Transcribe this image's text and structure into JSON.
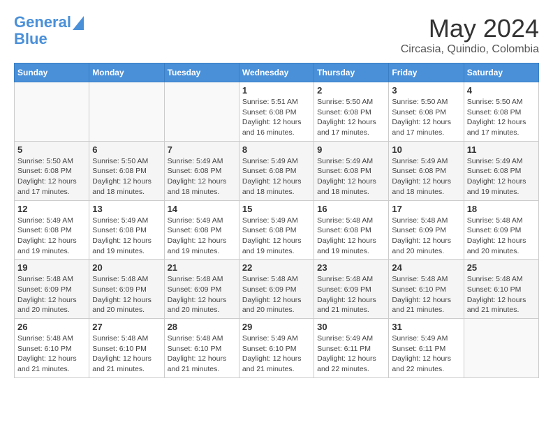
{
  "header": {
    "logo_line1": "General",
    "logo_line2": "Blue",
    "month": "May 2024",
    "location": "Circasia, Quindio, Colombia"
  },
  "days_of_week": [
    "Sunday",
    "Monday",
    "Tuesday",
    "Wednesday",
    "Thursday",
    "Friday",
    "Saturday"
  ],
  "weeks": [
    [
      {
        "day": "",
        "info": ""
      },
      {
        "day": "",
        "info": ""
      },
      {
        "day": "",
        "info": ""
      },
      {
        "day": "1",
        "info": "Sunrise: 5:51 AM\nSunset: 6:08 PM\nDaylight: 12 hours\nand 16 minutes."
      },
      {
        "day": "2",
        "info": "Sunrise: 5:50 AM\nSunset: 6:08 PM\nDaylight: 12 hours\nand 17 minutes."
      },
      {
        "day": "3",
        "info": "Sunrise: 5:50 AM\nSunset: 6:08 PM\nDaylight: 12 hours\nand 17 minutes."
      },
      {
        "day": "4",
        "info": "Sunrise: 5:50 AM\nSunset: 6:08 PM\nDaylight: 12 hours\nand 17 minutes."
      }
    ],
    [
      {
        "day": "5",
        "info": "Sunrise: 5:50 AM\nSunset: 6:08 PM\nDaylight: 12 hours\nand 17 minutes."
      },
      {
        "day": "6",
        "info": "Sunrise: 5:50 AM\nSunset: 6:08 PM\nDaylight: 12 hours\nand 18 minutes."
      },
      {
        "day": "7",
        "info": "Sunrise: 5:49 AM\nSunset: 6:08 PM\nDaylight: 12 hours\nand 18 minutes."
      },
      {
        "day": "8",
        "info": "Sunrise: 5:49 AM\nSunset: 6:08 PM\nDaylight: 12 hours\nand 18 minutes."
      },
      {
        "day": "9",
        "info": "Sunrise: 5:49 AM\nSunset: 6:08 PM\nDaylight: 12 hours\nand 18 minutes."
      },
      {
        "day": "10",
        "info": "Sunrise: 5:49 AM\nSunset: 6:08 PM\nDaylight: 12 hours\nand 18 minutes."
      },
      {
        "day": "11",
        "info": "Sunrise: 5:49 AM\nSunset: 6:08 PM\nDaylight: 12 hours\nand 19 minutes."
      }
    ],
    [
      {
        "day": "12",
        "info": "Sunrise: 5:49 AM\nSunset: 6:08 PM\nDaylight: 12 hours\nand 19 minutes."
      },
      {
        "day": "13",
        "info": "Sunrise: 5:49 AM\nSunset: 6:08 PM\nDaylight: 12 hours\nand 19 minutes."
      },
      {
        "day": "14",
        "info": "Sunrise: 5:49 AM\nSunset: 6:08 PM\nDaylight: 12 hours\nand 19 minutes."
      },
      {
        "day": "15",
        "info": "Sunrise: 5:49 AM\nSunset: 6:08 PM\nDaylight: 12 hours\nand 19 minutes."
      },
      {
        "day": "16",
        "info": "Sunrise: 5:48 AM\nSunset: 6:08 PM\nDaylight: 12 hours\nand 19 minutes."
      },
      {
        "day": "17",
        "info": "Sunrise: 5:48 AM\nSunset: 6:09 PM\nDaylight: 12 hours\nand 20 minutes."
      },
      {
        "day": "18",
        "info": "Sunrise: 5:48 AM\nSunset: 6:09 PM\nDaylight: 12 hours\nand 20 minutes."
      }
    ],
    [
      {
        "day": "19",
        "info": "Sunrise: 5:48 AM\nSunset: 6:09 PM\nDaylight: 12 hours\nand 20 minutes."
      },
      {
        "day": "20",
        "info": "Sunrise: 5:48 AM\nSunset: 6:09 PM\nDaylight: 12 hours\nand 20 minutes."
      },
      {
        "day": "21",
        "info": "Sunrise: 5:48 AM\nSunset: 6:09 PM\nDaylight: 12 hours\nand 20 minutes."
      },
      {
        "day": "22",
        "info": "Sunrise: 5:48 AM\nSunset: 6:09 PM\nDaylight: 12 hours\nand 20 minutes."
      },
      {
        "day": "23",
        "info": "Sunrise: 5:48 AM\nSunset: 6:09 PM\nDaylight: 12 hours\nand 21 minutes."
      },
      {
        "day": "24",
        "info": "Sunrise: 5:48 AM\nSunset: 6:10 PM\nDaylight: 12 hours\nand 21 minutes."
      },
      {
        "day": "25",
        "info": "Sunrise: 5:48 AM\nSunset: 6:10 PM\nDaylight: 12 hours\nand 21 minutes."
      }
    ],
    [
      {
        "day": "26",
        "info": "Sunrise: 5:48 AM\nSunset: 6:10 PM\nDaylight: 12 hours\nand 21 minutes."
      },
      {
        "day": "27",
        "info": "Sunrise: 5:48 AM\nSunset: 6:10 PM\nDaylight: 12 hours\nand 21 minutes."
      },
      {
        "day": "28",
        "info": "Sunrise: 5:48 AM\nSunset: 6:10 PM\nDaylight: 12 hours\nand 21 minutes."
      },
      {
        "day": "29",
        "info": "Sunrise: 5:49 AM\nSunset: 6:10 PM\nDaylight: 12 hours\nand 21 minutes."
      },
      {
        "day": "30",
        "info": "Sunrise: 5:49 AM\nSunset: 6:11 PM\nDaylight: 12 hours\nand 22 minutes."
      },
      {
        "day": "31",
        "info": "Sunrise: 5:49 AM\nSunset: 6:11 PM\nDaylight: 12 hours\nand 22 minutes."
      },
      {
        "day": "",
        "info": ""
      }
    ]
  ]
}
